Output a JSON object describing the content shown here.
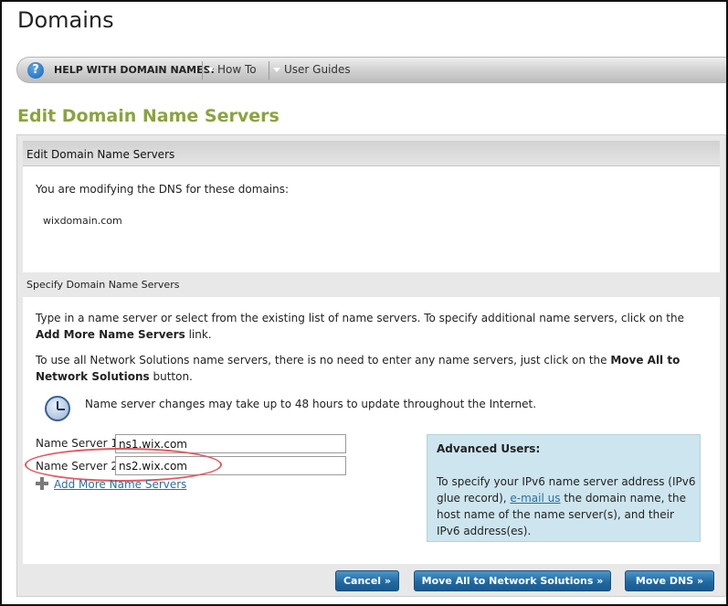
{
  "page": {
    "title": "Domains"
  },
  "help_bar": {
    "label": "HELP WITH DOMAIN NAMES:",
    "links": [
      "How To",
      "User Guides"
    ]
  },
  "section": {
    "title": "Edit Domain Name Servers"
  },
  "panel": {
    "header": "Edit Domain Name Servers",
    "modifying_text": "You are modifying the DNS for these domains:",
    "domain": "wixdomain.com",
    "specify_header": "Specify Domain Name Servers",
    "para1_a": "Type in a name server or select from the existing list of name servers. To specify additional name servers, click on the ",
    "para1_bold": "Add More Name Servers",
    "para1_b": " link.",
    "para2_a": "To use all Network Solutions name servers, there is no need to enter any name servers, just click on the ",
    "para2_bold": "Move All to Network Solutions",
    "para2_b": " button.",
    "clock_note": "Name server changes may take up to 48 hours to update throughout the Internet."
  },
  "name_servers": {
    "label1": "Name Server 1:",
    "value1": "ns1.wix.com",
    "label2": "Name Server 2:",
    "value2": "ns2.wix.com",
    "add_more": "Add More Name Servers"
  },
  "advanced": {
    "title": "Advanced Users:",
    "body_a": "To specify your IPv6 name server address (IPv6 glue record), ",
    "link": "e-mail us",
    "body_b": " the domain name, the host name of the name server(s), and their IPv6 address(es)."
  },
  "buttons": {
    "cancel": "Cancel »",
    "move_all": "Move All to Network Solutions »",
    "move_dns": "Move DNS »"
  },
  "colors": {
    "section_title": "#8aa33e",
    "button": "#1f6aa3",
    "advanced_bg": "#cde5ee",
    "highlight": "#e0595f"
  }
}
